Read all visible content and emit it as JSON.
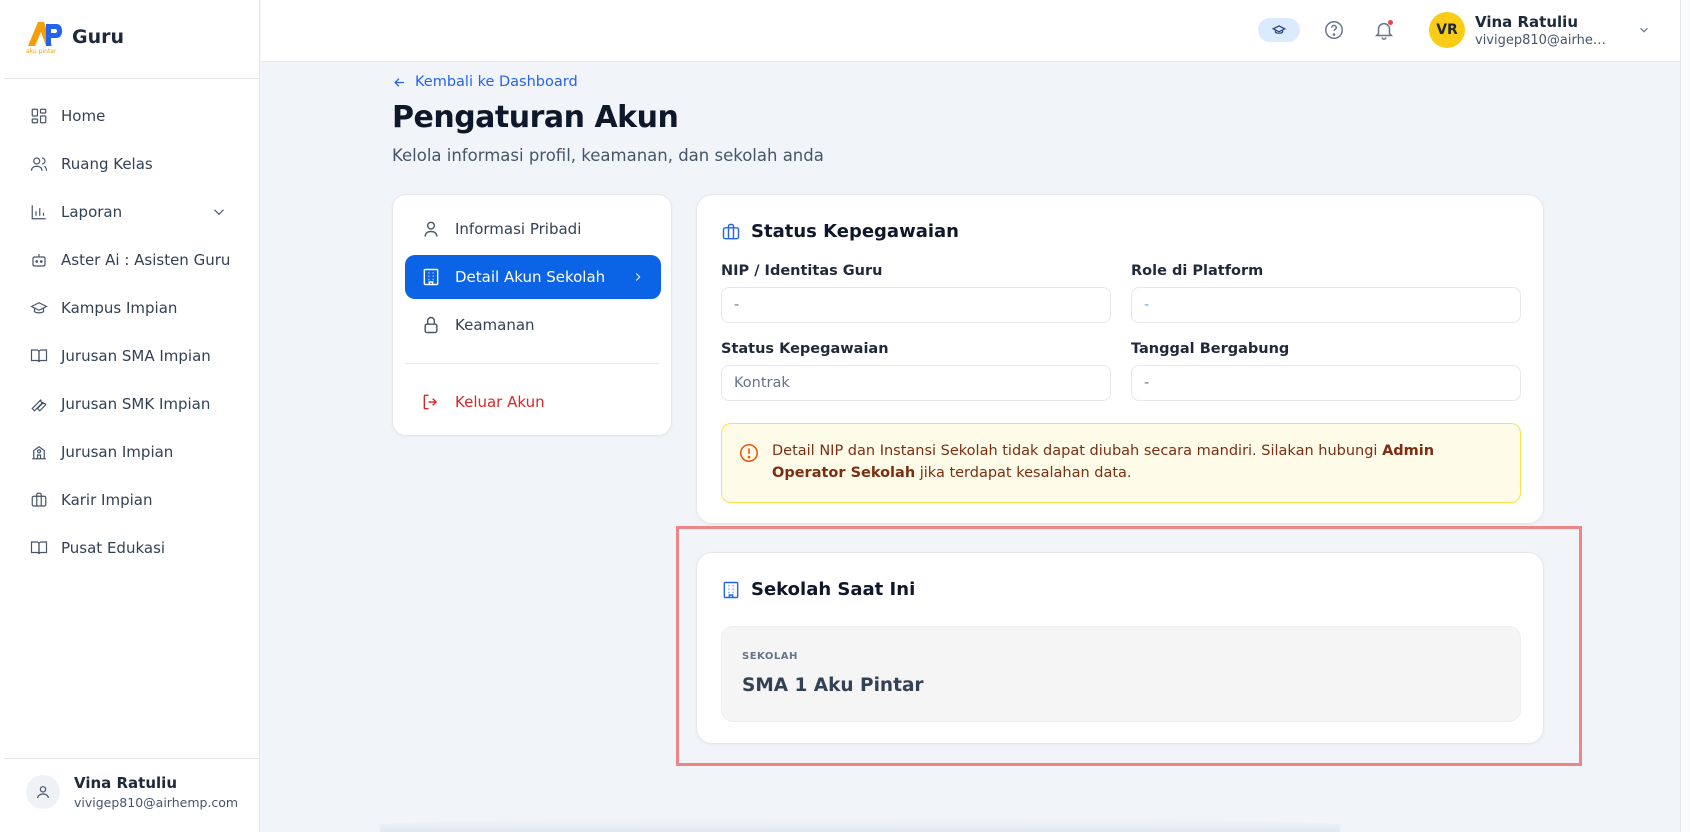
{
  "app": {
    "logo_small": "aku pintar",
    "role_label": "Guru"
  },
  "sidebar": {
    "items": [
      {
        "label": "Home",
        "icon": "grid-icon"
      },
      {
        "label": "Ruang Kelas",
        "icon": "users-icon"
      },
      {
        "label": "Laporan",
        "icon": "bar-chart-icon",
        "expandable": true
      },
      {
        "label": "Aster Ai : Asisten Guru",
        "icon": "bot-icon"
      },
      {
        "label": "Kampus Impian",
        "icon": "graduation-cap-icon"
      },
      {
        "label": "Jurusan SMA Impian",
        "icon": "book-open-icon"
      },
      {
        "label": "Jurusan SMK Impian",
        "icon": "wrench-icon"
      },
      {
        "label": "Jurusan Impian",
        "icon": "school-icon"
      },
      {
        "label": "Karir Impian",
        "icon": "briefcase-icon"
      },
      {
        "label": "Pusat Edukasi",
        "icon": "book-icon"
      }
    ],
    "user": {
      "name": "Vina Ratuliu",
      "email": "vivigep810@airhemp.com"
    }
  },
  "topbar": {
    "user": {
      "initials": "VR",
      "name": "Vina Ratuliu",
      "email": "vivigep810@airhemp...."
    }
  },
  "page": {
    "back_label": "Kembali ke Dashboard",
    "title": "Pengaturan Akun",
    "subtitle": "Kelola informasi profil, keamanan, dan sekolah anda"
  },
  "settings_menu": {
    "items": [
      {
        "label": "Informasi Pribadi",
        "active": false
      },
      {
        "label": "Detail Akun Sekolah",
        "active": true
      },
      {
        "label": "Keamanan",
        "active": false
      }
    ],
    "logout_label": "Keluar Akun"
  },
  "status_card": {
    "title": "Status Kepegawaian",
    "fields": {
      "nip": {
        "label": "NIP / Identitas Guru",
        "value": "-"
      },
      "role": {
        "label": "Role di Platform",
        "value": "-"
      },
      "status": {
        "label": "Status Kepegawaian",
        "value": "Kontrak"
      },
      "joined": {
        "label": "Tanggal Bergabung",
        "value": "-"
      }
    },
    "alert": {
      "text_before": "Detail NIP dan Instansi Sekolah tidak dapat diubah secara mandiri. Silakan hubungi ",
      "bold": "Admin Operator Sekolah",
      "text_after": " jika terdapat kesalahan data."
    }
  },
  "school_card": {
    "title": "Sekolah Saat Ini",
    "label": "SEKOLAH",
    "value": "SMA 1 Aku Pintar"
  },
  "colors": {
    "primary": "#0b63e5",
    "danger": "#dc2626",
    "alert_bg": "#fefce8",
    "highlight": "#f08585",
    "avatar": "#facc15"
  }
}
